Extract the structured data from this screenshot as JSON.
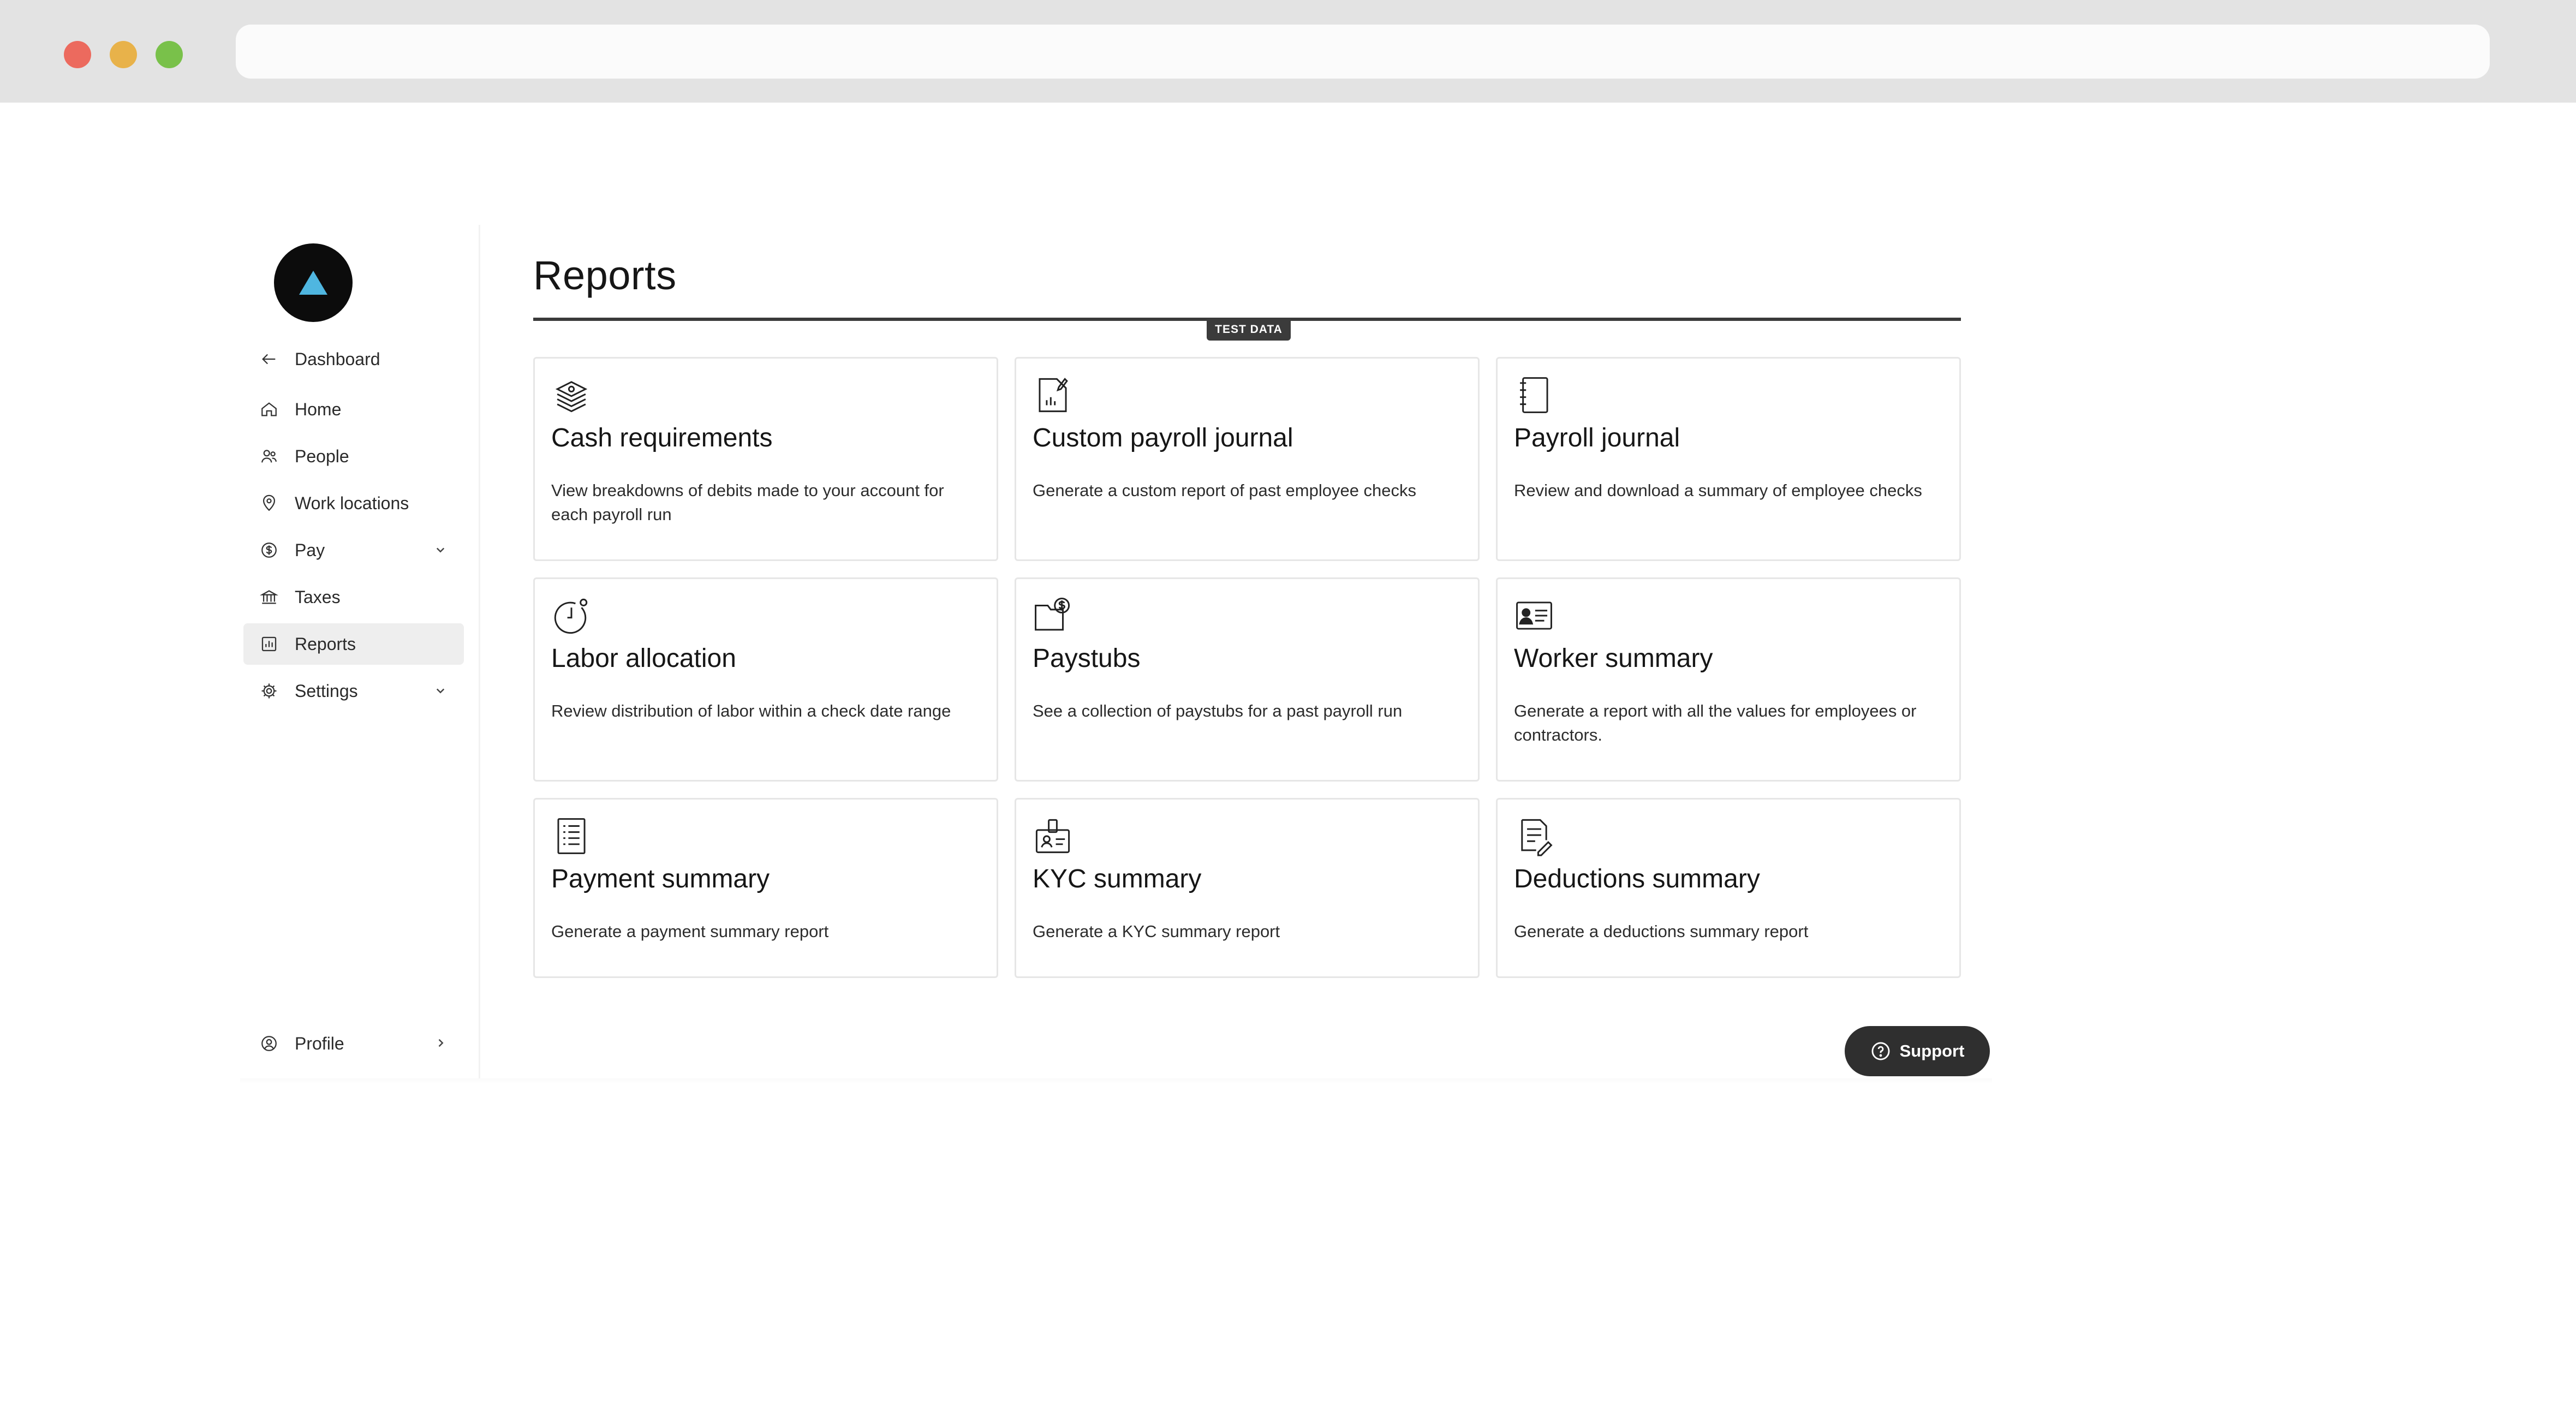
{
  "sidebar": {
    "back_label": "Dashboard",
    "items": [
      {
        "label": "Home",
        "icon": "home-icon"
      },
      {
        "label": "People",
        "icon": "people-icon"
      },
      {
        "label": "Work locations",
        "icon": "location-pin-icon"
      },
      {
        "label": "Pay",
        "icon": "dollar-circle-icon",
        "expandable": true
      },
      {
        "label": "Taxes",
        "icon": "bank-icon"
      },
      {
        "label": "Reports",
        "icon": "chart-icon",
        "active": true
      },
      {
        "label": "Settings",
        "icon": "gear-icon",
        "expandable": true
      }
    ],
    "profile_label": "Profile"
  },
  "main": {
    "title": "Reports",
    "badge": "TEST DATA",
    "cards": [
      {
        "title": "Cash requirements",
        "description": "View breakdowns of debits made to your account for each payroll run",
        "icon": "cash-stack-icon"
      },
      {
        "title": "Custom payroll journal",
        "description": "Generate a custom report of past employee checks",
        "icon": "document-chart-icon"
      },
      {
        "title": "Payroll journal",
        "description": "Review and download a summary of employee checks",
        "icon": "journal-icon"
      },
      {
        "title": "Labor allocation",
        "description": "Review distribution of labor within a check date range",
        "icon": "clock-icon"
      },
      {
        "title": "Paystubs",
        "description": "See a collection of paystubs for a past payroll run",
        "icon": "folder-dollar-icon"
      },
      {
        "title": "Worker summary",
        "description": "Generate a report with all the values for employees or contractors.",
        "icon": "id-card-icon"
      },
      {
        "title": "Payment summary",
        "description": "Generate a payment summary report",
        "icon": "list-document-icon"
      },
      {
        "title": "KYC summary",
        "description": "Generate a KYC summary report",
        "icon": "badge-icon"
      },
      {
        "title": "Deductions summary",
        "description": "Generate a deductions summary report",
        "icon": "document-pen-icon"
      }
    ]
  },
  "support_label": "Support",
  "colors": {
    "logo_bg": "#0c0c0c",
    "logo_accent": "#4fb6e0",
    "active_bg": "#eeeeee",
    "support_bg": "#2f2f2f"
  }
}
